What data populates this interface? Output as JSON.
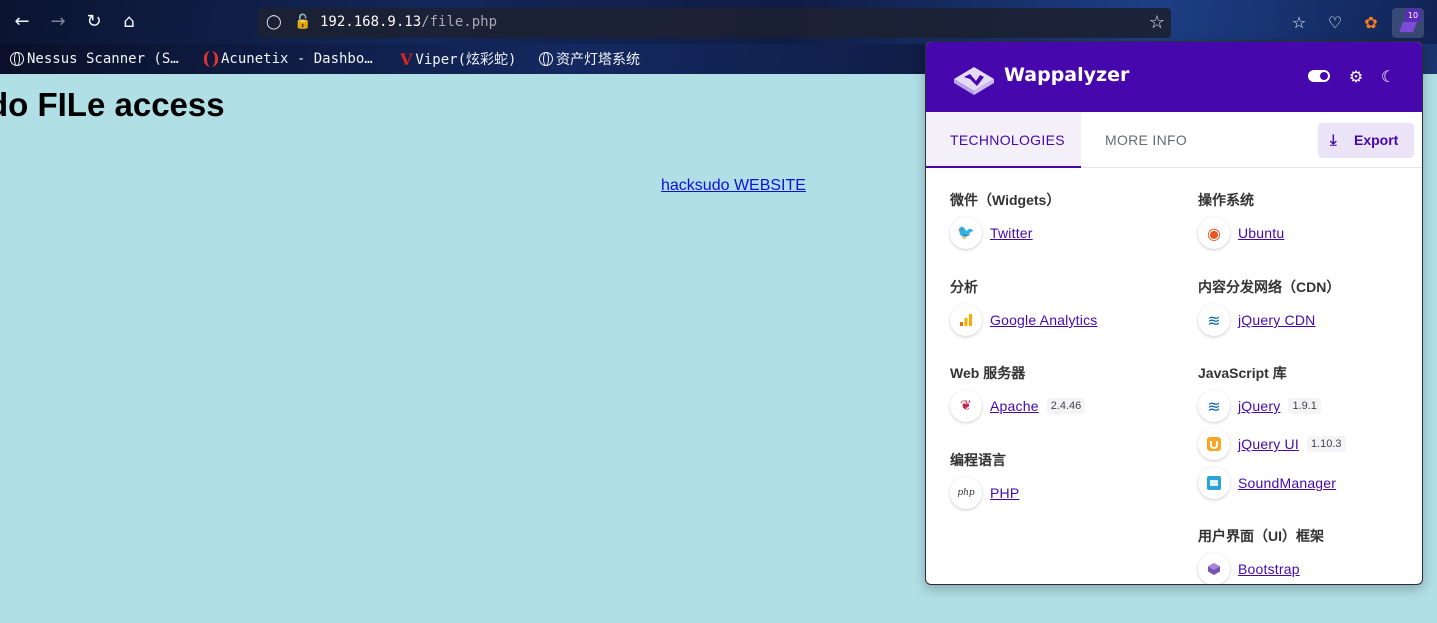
{
  "browser": {
    "url_host": "192.168.9.13",
    "url_path": "/file.php",
    "extension_badge": "10",
    "bookmarks": [
      {
        "label": "Nessus Scanner (S…",
        "icon": "globe-icon"
      },
      {
        "label": "Acunetix - Dashbo…",
        "icon": "acunetix-icon"
      },
      {
        "label": "Viper(炫彩蛇)",
        "icon": "viper-icon",
        "icon_text": "V"
      },
      {
        "label": "资产灯塔系统",
        "icon": "globe-icon"
      }
    ]
  },
  "page": {
    "heading": "do FILe access",
    "link": "hacksudo WEBSITE",
    "background_color": "#b0dfe5"
  },
  "wappalyzer": {
    "brand": "Wappalyzer",
    "accent_color": "#4608ad",
    "tabs": [
      "TECHNOLOGIES",
      "MORE INFO"
    ],
    "export_label": "Export",
    "left_column": [
      {
        "title": "微件（Widgets）",
        "items": [
          {
            "name": "Twitter",
            "version": "",
            "icon": "twitter-icon"
          }
        ]
      },
      {
        "title": "分析",
        "items": [
          {
            "name": "Google Analytics",
            "version": "",
            "icon": "google-analytics-icon"
          }
        ]
      },
      {
        "title": "Web 服务器",
        "items": [
          {
            "name": "Apache",
            "version": "2.4.46",
            "icon": "apache-icon"
          }
        ]
      },
      {
        "title": "编程语言",
        "items": [
          {
            "name": "PHP",
            "version": "",
            "icon": "php-icon",
            "icon_text": "php"
          }
        ]
      }
    ],
    "right_column": [
      {
        "title": "操作系统",
        "items": [
          {
            "name": "Ubuntu",
            "version": "",
            "icon": "ubuntu-icon"
          }
        ]
      },
      {
        "title": "内容分发网络（CDN）",
        "items": [
          {
            "name": "jQuery CDN",
            "version": "",
            "icon": "jquery-icon"
          }
        ]
      },
      {
        "title": "JavaScript 库",
        "items": [
          {
            "name": "jQuery",
            "version": "1.9.1",
            "icon": "jquery-icon"
          },
          {
            "name": "jQuery UI",
            "version": "1.10.3",
            "icon": "jquery-ui-icon"
          },
          {
            "name": "SoundManager",
            "version": "",
            "icon": "soundmanager-icon"
          }
        ]
      },
      {
        "title": "用户界面（UI）框架",
        "items": [
          {
            "name": "Bootstrap",
            "version": "",
            "icon": "bootstrap-icon"
          }
        ]
      }
    ]
  }
}
